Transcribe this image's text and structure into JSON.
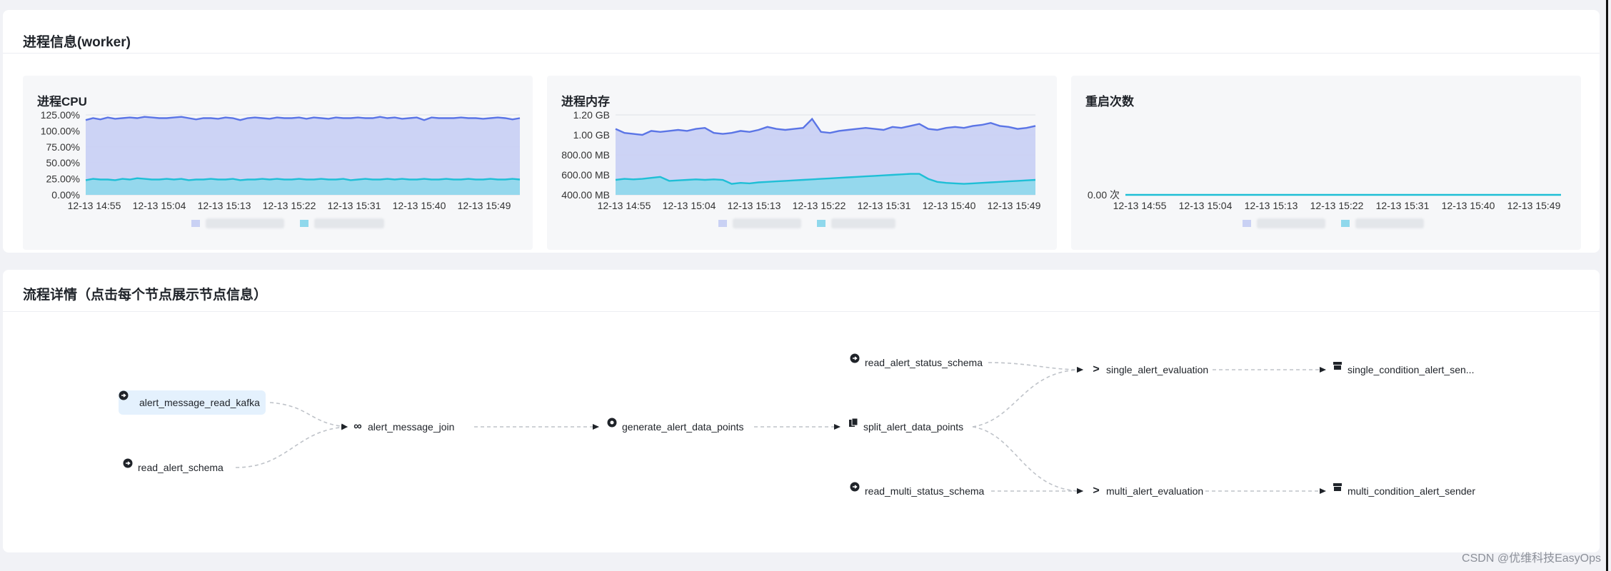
{
  "process_panel": {
    "title": "进程信息(worker)"
  },
  "charts": {
    "cpu": {
      "title": "进程CPU",
      "y_ticks": [
        "125.00%",
        "100.00%",
        "75.00%",
        "50.00%",
        "25.00%",
        "0.00%"
      ],
      "x_ticks": [
        "12-13 14:55",
        "12-13 15:04",
        "12-13 15:13",
        "12-13 15:22",
        "12-13 15:31",
        "12-13 15:40",
        "12-13 15:49"
      ]
    },
    "memory": {
      "title": "进程内存",
      "y_ticks": [
        "1.20 GB",
        "1.00 GB",
        "800.00 MB",
        "600.00 MB",
        "400.00 MB"
      ],
      "x_ticks": [
        "12-13 14:55",
        "12-13 15:04",
        "12-13 15:13",
        "12-13 15:22",
        "12-13 15:31",
        "12-13 15:40",
        "12-13 15:49"
      ]
    },
    "restarts": {
      "title": "重启次数",
      "y_ticks": [
        "0.00 次"
      ],
      "x_ticks": [
        "12-13 14:55",
        "12-13 15:04",
        "12-13 15:13",
        "12-13 15:22",
        "12-13 15:31",
        "12-13 15:40",
        "12-13 15:49"
      ]
    }
  },
  "chart_data": [
    {
      "type": "area",
      "title": "进程CPU",
      "categories": [
        "12-13 14:55",
        "12-13 15:04",
        "12-13 15:13",
        "12-13 15:22",
        "12-13 15:31",
        "12-13 15:40",
        "12-13 15:49"
      ],
      "ylim": [
        0,
        125
      ],
      "series": [
        {
          "values": [
            117,
            120,
            118,
            121,
            119,
            120,
            121,
            120,
            122,
            121,
            120,
            120,
            121,
            122,
            120,
            118,
            120,
            120,
            119,
            121,
            120,
            117,
            120,
            121,
            120,
            119,
            121,
            120,
            120,
            121,
            119,
            121,
            120,
            119,
            121,
            120,
            120,
            121,
            120,
            120,
            122,
            120,
            121,
            119,
            120,
            121,
            117,
            121,
            120,
            120,
            120,
            121,
            120,
            120,
            119,
            120,
            121,
            120,
            118,
            120
          ]
        },
        {
          "values": [
            23,
            25,
            24,
            24,
            23,
            25,
            24,
            26,
            25,
            24,
            24,
            25,
            24,
            25,
            23,
            24,
            24,
            25,
            24,
            24,
            25,
            23,
            24,
            24,
            25,
            24,
            25,
            24,
            24,
            25,
            24,
            24,
            25,
            24,
            24,
            25,
            23,
            24,
            25,
            24,
            24,
            25,
            24,
            25,
            24,
            24,
            25,
            24,
            24,
            25,
            24,
            24,
            25,
            24,
            24,
            25,
            24,
            24,
            25,
            24
          ]
        }
      ]
    },
    {
      "type": "area",
      "title": "进程内存",
      "categories": [
        "12-13 14:55",
        "12-13 15:04",
        "12-13 15:13",
        "12-13 15:22",
        "12-13 15:31",
        "12-13 15:40",
        "12-13 15:49"
      ],
      "ylim": [
        400,
        1200
      ],
      "series": [
        {
          "values": [
            1060,
            1020,
            1010,
            1000,
            1040,
            1030,
            1040,
            1050,
            1040,
            1060,
            1070,
            1020,
            1010,
            1020,
            1040,
            1030,
            1050,
            1080,
            1060,
            1050,
            1060,
            1070,
            1160,
            1030,
            1020,
            1040,
            1050,
            1060,
            1070,
            1060,
            1050,
            1080,
            1070,
            1090,
            1110,
            1060,
            1050,
            1070,
            1080,
            1070,
            1090,
            1100,
            1120,
            1090,
            1080,
            1060,
            1070,
            1090
          ]
        },
        {
          "values": [
            550,
            560,
            555,
            560,
            570,
            580,
            540,
            545,
            550,
            555,
            550,
            555,
            550,
            510,
            520,
            515,
            525,
            530,
            535,
            540,
            545,
            550,
            555,
            560,
            565,
            570,
            575,
            580,
            585,
            590,
            595,
            600,
            605,
            610,
            610,
            560,
            530,
            520,
            515,
            510,
            515,
            520,
            525,
            530,
            535,
            540,
            545,
            550
          ]
        }
      ]
    },
    {
      "type": "line",
      "title": "重启次数",
      "categories": [
        "12-13 14:55",
        "12-13 15:04",
        "12-13 15:13",
        "12-13 15:22",
        "12-13 15:31",
        "12-13 15:40",
        "12-13 15:49"
      ],
      "series": [
        {
          "values": [
            0,
            0,
            0,
            0,
            0,
            0,
            0
          ]
        }
      ]
    }
  ],
  "flow_panel": {
    "title": "流程详情（点击每个节点展示节点信息）"
  },
  "flow_nodes": {
    "kafka": "alert_message_read_kafka",
    "schema": "read_alert_schema",
    "join": "alert_message_join",
    "gen": "generate_alert_data_points",
    "split": "split_alert_data_points",
    "status": "read_alert_status_schema",
    "multi_status": "read_multi_status_schema",
    "single_eval": "single_alert_evaluation",
    "multi_eval": "multi_alert_evaluation",
    "single_send": "single_condition_alert_sen...",
    "multi_send": "multi_condition_alert_sender"
  },
  "colors": {
    "series_1": "#5b75e6",
    "series_1_fill": "#c9d1f4",
    "series_2": "#1fbfd6",
    "series_2_fill": "#8fd8ec"
  },
  "watermark": "CSDN @优维科技EasyOps"
}
